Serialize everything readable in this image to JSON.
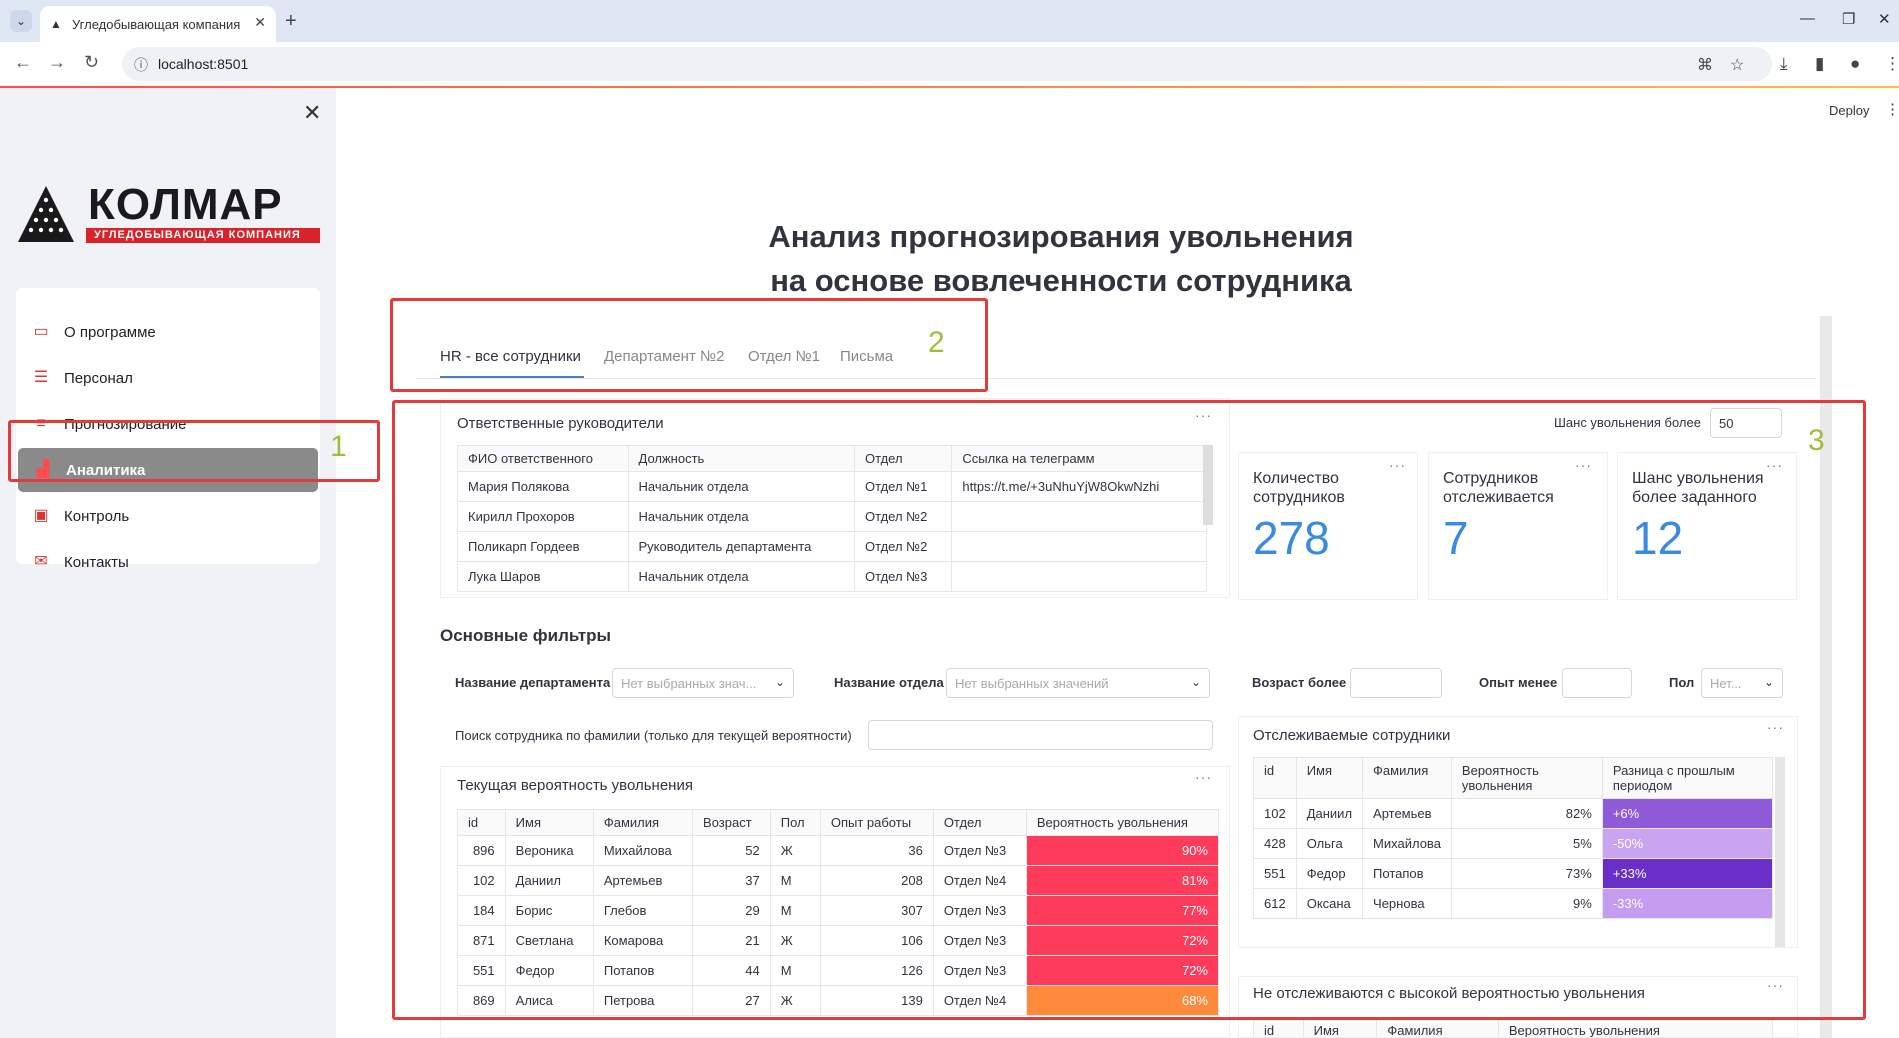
{
  "browser": {
    "tab_title": "Угледобывающая компания «",
    "url": "localhost:8501"
  },
  "sidebar": {
    "logo_name": "КОЛМАР",
    "logo_sub": "УГЛЕДОБЫВАЮЩАЯ КОМПАНИЯ",
    "items": [
      {
        "label": "О программе",
        "icon": "monitor-icon"
      },
      {
        "label": "Персонал",
        "icon": "database-icon"
      },
      {
        "label": "Прогнозирование",
        "icon": "list-icon"
      },
      {
        "label": "Аналитика",
        "icon": "bar-chart-icon"
      },
      {
        "label": "Контроль",
        "icon": "clipboard-icon"
      },
      {
        "label": "Контакты",
        "icon": "mail-icon"
      }
    ],
    "active": "Аналитика"
  },
  "header": {
    "deploy": "Deploy"
  },
  "page": {
    "title_line1": "Анализ прогнозирования увольнения",
    "title_line2": "на основе вовлеченности сотрудника"
  },
  "tabs": [
    "HR - все сотрудники",
    "Департамент №2",
    "Отдел №1",
    "Письма"
  ],
  "annotations": [
    "1",
    "2",
    "3"
  ],
  "managers": {
    "title": "Ответственные руководители",
    "columns": [
      "ФИО ответственного",
      "Должность",
      "Отдел",
      "Ссылка на телеграмм"
    ],
    "rows": [
      [
        "Мария Полякова",
        "Начальник отдела",
        "Отдел №1",
        "https://t.me/+3uNhuYjW8OkwNzhi"
      ],
      [
        "Кирилл Прохоров",
        "Начальник отдела",
        "Отдел №2",
        ""
      ],
      [
        "Поликарп Гордеев",
        "Руководитель департамента",
        "Отдел №2",
        ""
      ],
      [
        "Лука Шаров",
        "Начальник отдела",
        "Отдел №3",
        ""
      ]
    ]
  },
  "threshold": {
    "label": "Шанс увольнения более",
    "value": "50"
  },
  "metrics": [
    {
      "label_1": "Количество",
      "label_2": "сотрудников",
      "value": "278"
    },
    {
      "label_1": "Сотрудников",
      "label_2": "отслеживается",
      "value": "7"
    },
    {
      "label_1": "Шанс увольнения",
      "label_2": "более заданного",
      "value": "12"
    }
  ],
  "filters": {
    "title": "Основные фильтры",
    "dept_label": "Название департамента",
    "dept_placeholder": "Нет выбранных знач...",
    "otdel_label": "Название отдела",
    "otdel_placeholder": "Нет выбранных значений",
    "age_label": "Возраст более",
    "exp_label": "Опыт менее",
    "sex_label": "Пол",
    "sex_placeholder": "Нет...",
    "search_label": "Поиск сотрудника по фамилии (только для текущей вероятности)"
  },
  "current": {
    "title": "Текущая вероятность увольнения",
    "columns": [
      "id",
      "Имя",
      "Фамилия",
      "Возраст",
      "Пол",
      "Опыт работы",
      "Отдел",
      "Вероятность увольнения"
    ],
    "rows": [
      [
        "896",
        "Вероника",
        "Михайлова",
        "52",
        "Ж",
        "36",
        "Отдел №3",
        "90%"
      ],
      [
        "102",
        "Даниил",
        "Артемьев",
        "37",
        "М",
        "208",
        "Отдел №4",
        "81%"
      ],
      [
        "184",
        "Борис",
        "Глебов",
        "29",
        "М",
        "307",
        "Отдел №3",
        "77%"
      ],
      [
        "871",
        "Светлана",
        "Комарова",
        "21",
        "Ж",
        "106",
        "Отдел №3",
        "72%"
      ],
      [
        "551",
        "Федор",
        "Потапов",
        "44",
        "М",
        "126",
        "Отдел №3",
        "72%"
      ],
      [
        "869",
        "Алиса",
        "Петрова",
        "27",
        "Ж",
        "139",
        "Отдел №4",
        "68%"
      ]
    ],
    "colors": [
      "#ff3b5c",
      "#ff3b5c",
      "#ff3b5c",
      "#ff3b5c",
      "#ff3b5c",
      "#ff8a3b"
    ]
  },
  "tracked": {
    "title": "Отслеживаемые сотрудники",
    "columns": [
      "id",
      "Имя",
      "Фамилия",
      "Вероятность увольнения",
      "Разница с прошлым периодом"
    ],
    "rows": [
      [
        "102",
        "Даниил",
        "Артемьев",
        "82%",
        "+6%"
      ],
      [
        "428",
        "Ольга",
        "Михайлова",
        "5%",
        "-50%"
      ],
      [
        "551",
        "Федор",
        "Потапов",
        "73%",
        "+33%"
      ],
      [
        "612",
        "Оксана",
        "Чернова",
        "9%",
        "-33%"
      ]
    ],
    "colors": [
      "#8e5ad8",
      "#c9a5f0",
      "#6a2fc9",
      "#c49cf0"
    ]
  },
  "untracked": {
    "title": "Не отслеживаются с высокой вероятностью увольнения",
    "columns": [
      "id",
      "Имя",
      "Фамилия",
      "Вероятность увольнения"
    ]
  }
}
